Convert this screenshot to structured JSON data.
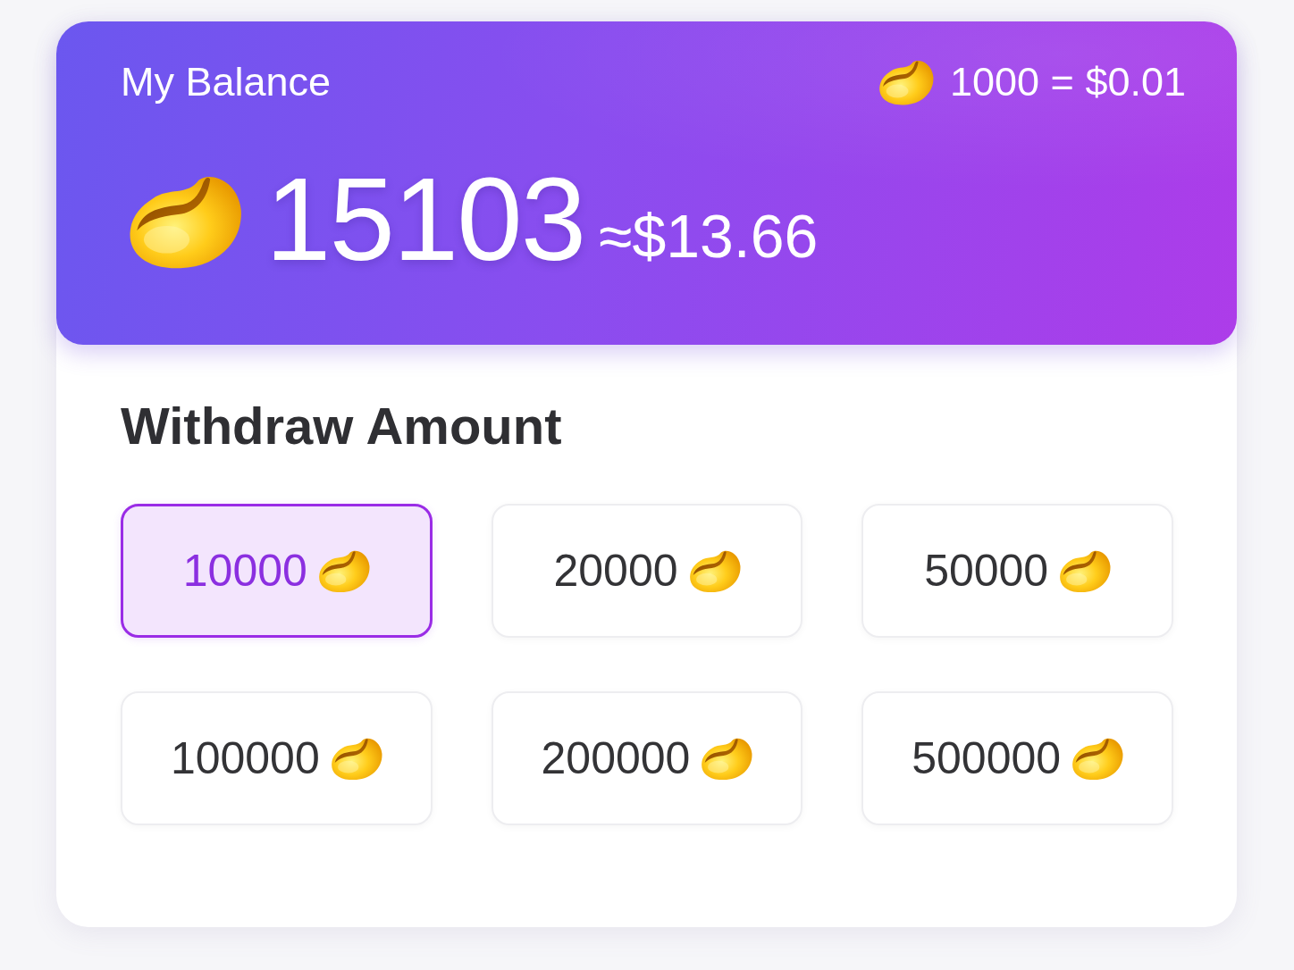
{
  "balance_card": {
    "title": "My Balance",
    "rate": "1000 = $0.01",
    "balance": "15103",
    "balance_usd": "≈$13.66"
  },
  "withdraw": {
    "title": "Withdraw Amount",
    "options": [
      {
        "amount": "10000",
        "selected": true
      },
      {
        "amount": "20000",
        "selected": false
      },
      {
        "amount": "50000",
        "selected": false
      },
      {
        "amount": "100000",
        "selected": false
      },
      {
        "amount": "200000",
        "selected": false
      },
      {
        "amount": "500000",
        "selected": false
      }
    ]
  }
}
